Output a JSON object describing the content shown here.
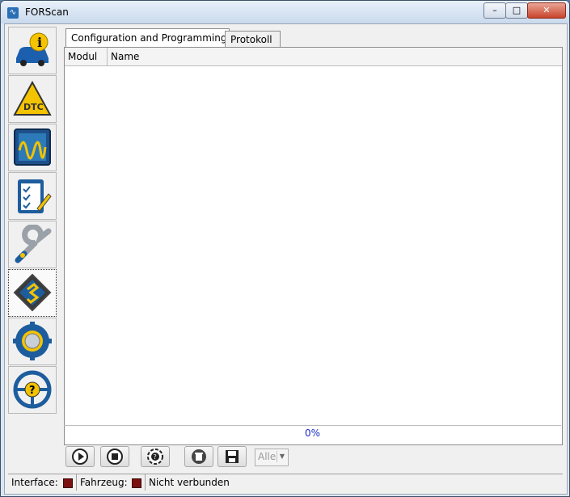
{
  "window": {
    "title": "FORScan",
    "min_label": "–",
    "max_label": "□",
    "close_label": "✕"
  },
  "sidebar": {
    "items": [
      {
        "name": "vehicle-info",
        "icon": "car-info-icon"
      },
      {
        "name": "dtc",
        "icon": "dtc-warning-icon",
        "label": "DTC"
      },
      {
        "name": "oscilloscope",
        "icon": "oscilloscope-icon"
      },
      {
        "name": "tests",
        "icon": "checklist-icon"
      },
      {
        "name": "service",
        "icon": "wrench-icon"
      },
      {
        "name": "configuration",
        "icon": "chip-icon",
        "active": true
      },
      {
        "name": "settings",
        "icon": "gear-icon"
      },
      {
        "name": "help",
        "icon": "steering-help-icon"
      }
    ]
  },
  "tabs": [
    {
      "label": "Configuration and Programming",
      "active": true
    },
    {
      "label": "Protokoll",
      "active": false
    }
  ],
  "table": {
    "columns": [
      "Modul",
      "Name"
    ],
    "rows": []
  },
  "progress": {
    "text": "0%",
    "value": 0
  },
  "toolbar": {
    "buttons": [
      "play-icon",
      "stop-icon",
      "help-circle-icon",
      "delete-icon",
      "save-icon"
    ],
    "filter": {
      "value": "Alle"
    }
  },
  "status": {
    "interface_label": "Interface:",
    "vehicle_label": "Fahrzeug:",
    "state": "Nicht verbunden",
    "led_color": "#7a1010"
  }
}
